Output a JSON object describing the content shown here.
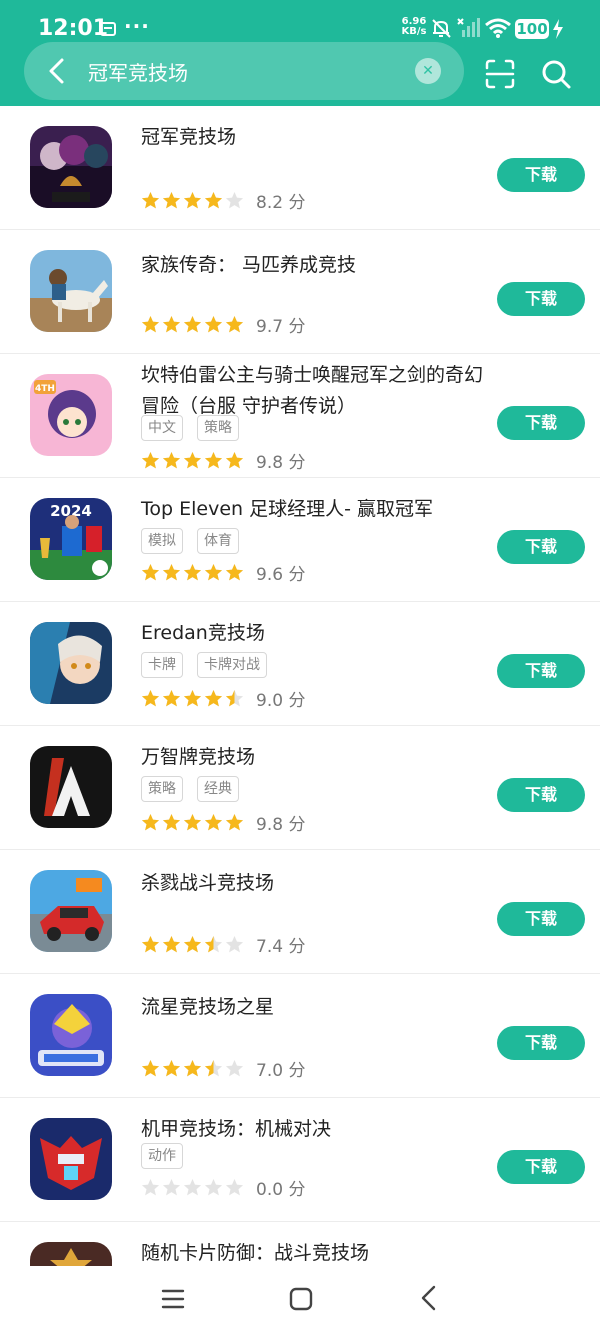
{
  "status_bar": {
    "time": "12:01",
    "dots": "···",
    "net_speed_value": "6.96",
    "net_speed_unit": "KB/s",
    "battery": "100"
  },
  "search": {
    "query": "冠军竞技场",
    "placeholder": ""
  },
  "colors": {
    "accent": "#1fb99a",
    "star_on": "#f6b81c",
    "star_off": "#e3e3e3"
  },
  "download_label": "下载",
  "apps": [
    {
      "title": "冠军竞技场",
      "tags": [],
      "stars": 4,
      "score": "8.2 分"
    },
    {
      "title": "家族传奇： 马匹养成竞技",
      "tags": [],
      "stars": 5,
      "score": "9.7 分"
    },
    {
      "title": "坎特伯雷公主与骑士唤醒冠军之剑的奇幻冒险（台服 守护者传说）",
      "tags": [
        "中文",
        "策略"
      ],
      "stars": 5,
      "score": "9.8 分"
    },
    {
      "title": "Top Eleven 足球经理人- 赢取冠军",
      "tags": [
        "模拟",
        "体育"
      ],
      "stars": 5,
      "score": "9.6 分"
    },
    {
      "title": "Eredan竞技场",
      "tags": [
        "卡牌",
        "卡牌对战"
      ],
      "stars": 4.5,
      "score": "9.0 分"
    },
    {
      "title": "万智牌竞技场",
      "tags": [
        "策略",
        "经典"
      ],
      "stars": 5,
      "score": "9.8 分"
    },
    {
      "title": "杀戮战斗竞技场",
      "tags": [],
      "stars": 3.5,
      "score": "7.4 分"
    },
    {
      "title": "流星竞技场之星",
      "tags": [],
      "stars": 3.5,
      "score": "7.0 分"
    },
    {
      "title": "机甲竞技场：机械对决",
      "tags": [
        "动作"
      ],
      "stars": 0,
      "score": "0.0 分"
    },
    {
      "title": "随机卡片防御：战斗竞技场",
      "tags": [],
      "stars": 0,
      "score": ""
    }
  ],
  "icons": {
    "back": "chevron-left-icon",
    "clear": "close-icon",
    "scan": "scan-icon",
    "search": "search-icon",
    "nav_menu": "menu-icon",
    "nav_home": "home-icon",
    "nav_back": "back-icon"
  }
}
